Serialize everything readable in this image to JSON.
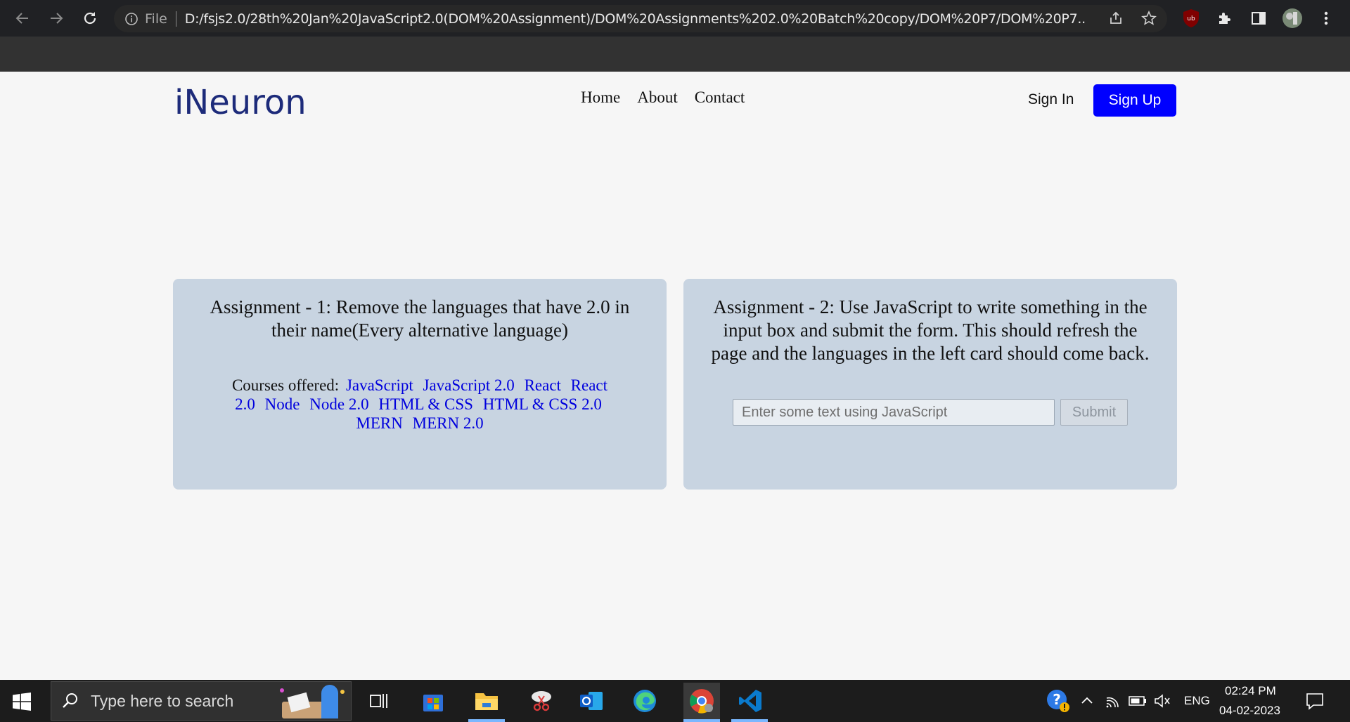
{
  "browser": {
    "omnibox_label": "File",
    "url": "D:/fsjs2.0/28th%20Jan%20JavaScript2.0(DOM%20Assignment)/DOM%20Assignments%202.0%20Batch%20copy/DOM%20P7/DOM%20P7...",
    "extension_badge": "ub"
  },
  "header": {
    "logo": "iNeuron",
    "nav": [
      "Home",
      "About",
      "Contact"
    ],
    "sign_in": "Sign In",
    "sign_up": "Sign Up"
  },
  "card1": {
    "title": "Assignment - 1: Remove the languages that have 2.0 in their name(Every alternative language)",
    "courses_label": "Courses offered:",
    "languages": [
      "JavaScript",
      "JavaScript 2.0",
      "React",
      "React 2.0",
      "Node",
      "Node 2.0",
      "HTML & CSS",
      "HTML & CSS 2.0",
      "MERN",
      "MERN 2.0"
    ]
  },
  "card2": {
    "title": "Assignment - 2: Use JavaScript to write something in the input box and submit the form. This should refresh the page and the languages in the left card should come back.",
    "input_placeholder": "Enter some text using JavaScript",
    "submit_label": "Submit"
  },
  "taskbar": {
    "search_placeholder": "Type here to search",
    "language": "ENG",
    "time": "02:24 PM",
    "date": "04-02-2023"
  },
  "colors": {
    "primary_button": "#0000ff",
    "card_bg": "#c8d4e1",
    "link": "#0000dd",
    "logo": "#1d2b7a"
  }
}
